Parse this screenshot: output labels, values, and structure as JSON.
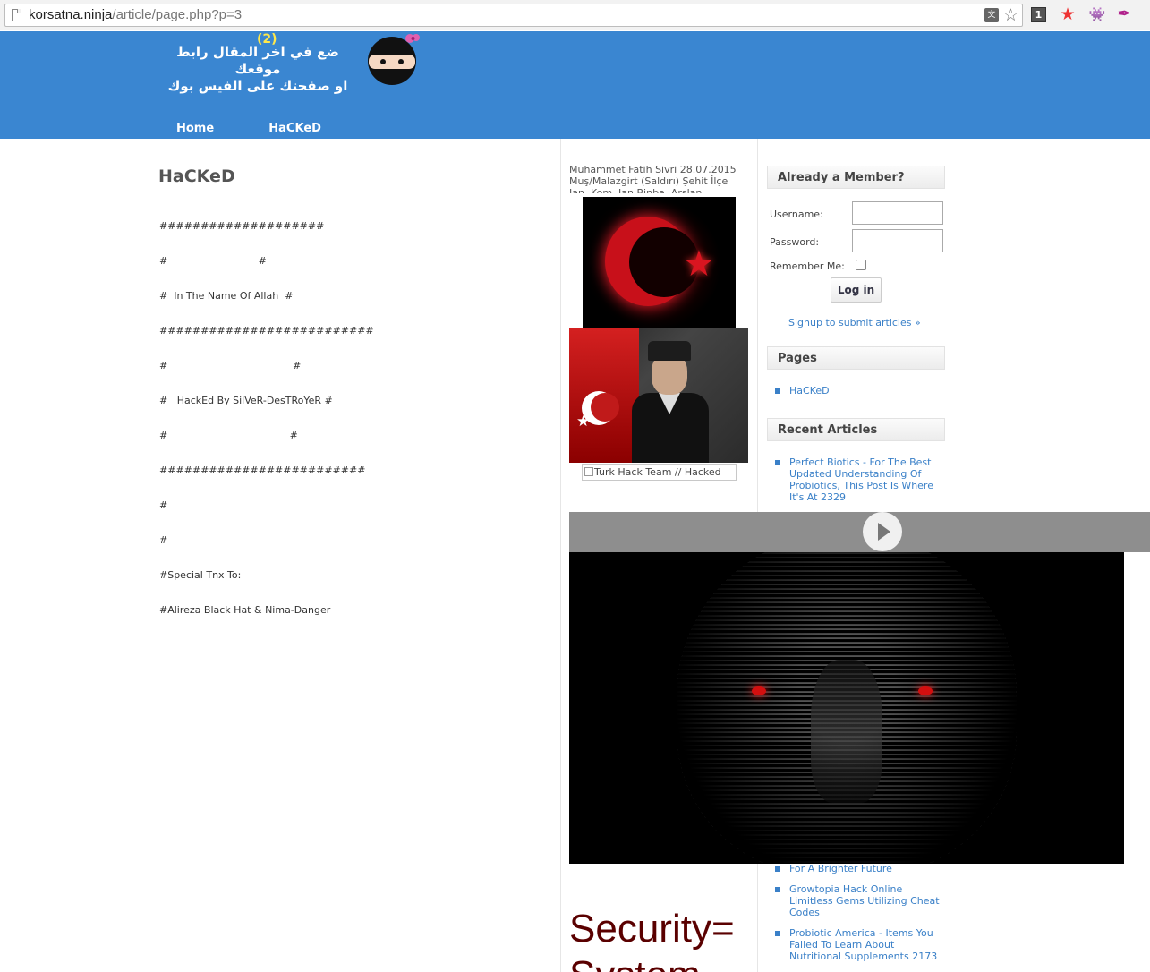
{
  "browser": {
    "url_host": "korsatna.ninja",
    "url_path": "/article/page.php?p=3",
    "ext_badge": "1"
  },
  "header": {
    "banner_line1": "ضع في اخر المقال رابط موقعك",
    "banner_line2": "او صفحتك على الفيس بوك",
    "banner_count": "(2)",
    "nav": [
      "Home",
      "HaCKeD"
    ]
  },
  "article": {
    "title": "HaCKeD",
    "body_lines": [
      "####################",
      "#                             #",
      "#  In The Name Of Allah  #",
      "##########################",
      "#                                        #",
      "#   HackEd By SilVeR-DesTRoYeR #",
      "#                                       #",
      "#########################",
      "#",
      "#",
      "#Special Tnx To:",
      "#Alireza Black Hat & Nima-Danger"
    ]
  },
  "middle": {
    "meta_text": "Muhammet Fatih Sivri 28.07.2015 Muş/Malazgirt (Saldırı) Şehit İlçe Jan. Kom. Jan Binba. Arslan",
    "broken_image_alt": "Turk Hack Team // Hacked",
    "security_text": "Security=",
    "security_text2": "System"
  },
  "sidebar": {
    "member_heading": "Already a Member?",
    "username_label": "Username:",
    "password_label": "Password:",
    "remember_label": "Remember Me:",
    "login_button": "Log in",
    "signup_link": "Signup to submit articles »",
    "pages_heading": "Pages",
    "pages": [
      "HaCKeD"
    ],
    "recent_heading": "Recent Articles",
    "recent_top": [
      "Perfect Biotics - For The Best Updated Understanding Of Probiotics, This Post Is Where It's At 2329"
    ],
    "recent_bottom": [
      "For A Brighter Future",
      "Growtopia Hack Online Limitless Gems Utilizing Cheat Codes",
      "Probiotic America - Items You Failed To Learn About Nutritional Supplements 2173"
    ]
  }
}
